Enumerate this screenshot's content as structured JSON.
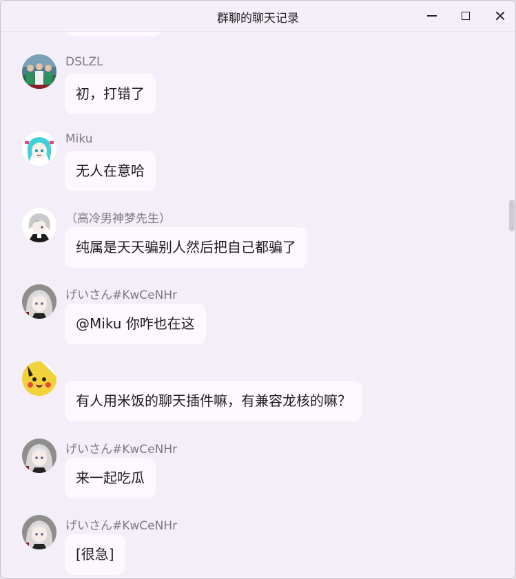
{
  "window": {
    "title": "群聊的聊天记录"
  },
  "messages": [
    {
      "sender": "DSLZL",
      "text": "初，打错了",
      "avatar": "group-photo-avatar"
    },
    {
      "sender": "Miku",
      "text": "无人在意哈",
      "avatar": "miku-avatar"
    },
    {
      "sender": "（高冷男神梦先生）",
      "text": "纯属是天天骗别人然后把自己都骗了",
      "avatar": "silver-hair-avatar"
    },
    {
      "sender": "げいさん#KwCeNHr",
      "text": "@Miku 你咋也在这",
      "avatar": "anime-girl-avatar"
    },
    {
      "sender": "",
      "text": "有人用米饭的聊天插件嘛，有兼容龙核的嘛？",
      "avatar": "pikachu-avatar"
    },
    {
      "sender": "げいさん#KwCeNHr",
      "text": "来一起吃瓜",
      "avatar": "anime-girl-avatar"
    },
    {
      "sender": "げいさん#KwCeNHr",
      "text": "[很急]",
      "avatar": "anime-girl-avatar"
    }
  ]
}
